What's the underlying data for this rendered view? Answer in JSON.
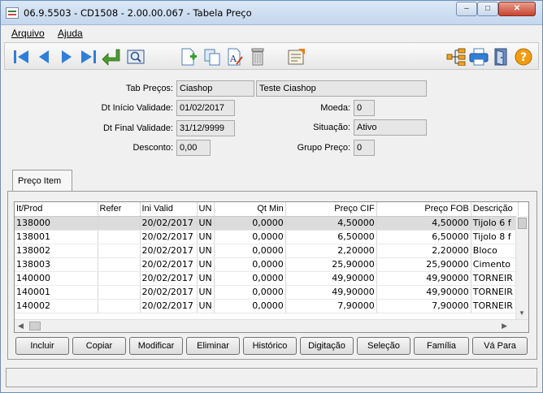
{
  "window": {
    "title": "06.9.5503 - CD1508 - 2.00.00.067 - Tabela Preço"
  },
  "title_buttons": {
    "minimize": "–",
    "maximize": "□",
    "close": "✕"
  },
  "menu": [
    {
      "label": "Arquivo"
    },
    {
      "label": "Ajuda"
    }
  ],
  "toolbar": {
    "icons": [
      "first-icon",
      "prev-icon",
      "next-icon",
      "last-icon",
      "return-icon",
      "zoom-icon",
      "new-icon",
      "copy-icon",
      "edit-icon",
      "delete-icon",
      "report-icon",
      "tree-icon",
      "print-icon",
      "exit-icon",
      "help-icon"
    ],
    "colors": {
      "nav_blue": "#2f7fd8",
      "return_green": "#4a9b2e",
      "help_orange": "#f39c12"
    }
  },
  "form": {
    "tab_precos_label": "Tab Preços:",
    "tab_precos_code": "Ciashop",
    "tab_precos_desc": "Teste Ciashop",
    "dt_inicio_label": "Dt Início Validade:",
    "dt_inicio_value": "01/02/2017",
    "dt_final_label": "Dt Final Validade:",
    "dt_final_value": "31/12/9999",
    "desconto_label": "Desconto:",
    "desconto_value": "0,00",
    "moeda_label": "Moeda:",
    "moeda_value": "0",
    "situacao_label": "Situação:",
    "situacao_value": "Ativo",
    "grupo_preco_label": "Grupo Preço:",
    "grupo_preco_value": "0"
  },
  "tabs": [
    {
      "label": "Preço Item"
    }
  ],
  "grid": {
    "headers": [
      "It/Prod",
      "Refer",
      "Ini Valid",
      "UN",
      "Qt Min",
      "Preço CIF",
      "Preço FOB",
      "Descrição"
    ],
    "rows": [
      [
        "138000",
        "",
        "20/02/2017",
        "UN",
        "0,0000",
        "4,50000",
        "4,50000",
        "Tijolo 6 f"
      ],
      [
        "138001",
        "",
        "20/02/2017",
        "UN",
        "0,0000",
        "6,50000",
        "6,50000",
        "Tijolo 8 f"
      ],
      [
        "138002",
        "",
        "20/02/2017",
        "UN",
        "0,0000",
        "2,20000",
        "2,20000",
        "Bloco"
      ],
      [
        "138003",
        "",
        "20/02/2017",
        "UN",
        "0,0000",
        "25,90000",
        "25,90000",
        "Cimento"
      ],
      [
        "140000",
        "",
        "20/02/2017",
        "UN",
        "0,0000",
        "49,90000",
        "49,90000",
        "TORNEIR"
      ],
      [
        "140001",
        "",
        "20/02/2017",
        "UN",
        "0,0000",
        "49,90000",
        "49,90000",
        "TORNEIR"
      ],
      [
        "140002",
        "",
        "20/02/2017",
        "UN",
        "0,0000",
        "7,90000",
        "7,90000",
        "TORNEIR"
      ]
    ]
  },
  "buttons": [
    {
      "label": "Incluir"
    },
    {
      "label": "Copiar"
    },
    {
      "label": "Modificar"
    },
    {
      "label": "Eliminar"
    },
    {
      "label": "Histórico"
    },
    {
      "label": "Digitação"
    },
    {
      "label": "Seleção"
    },
    {
      "label": "Família"
    },
    {
      "label": "Vá Para"
    }
  ]
}
